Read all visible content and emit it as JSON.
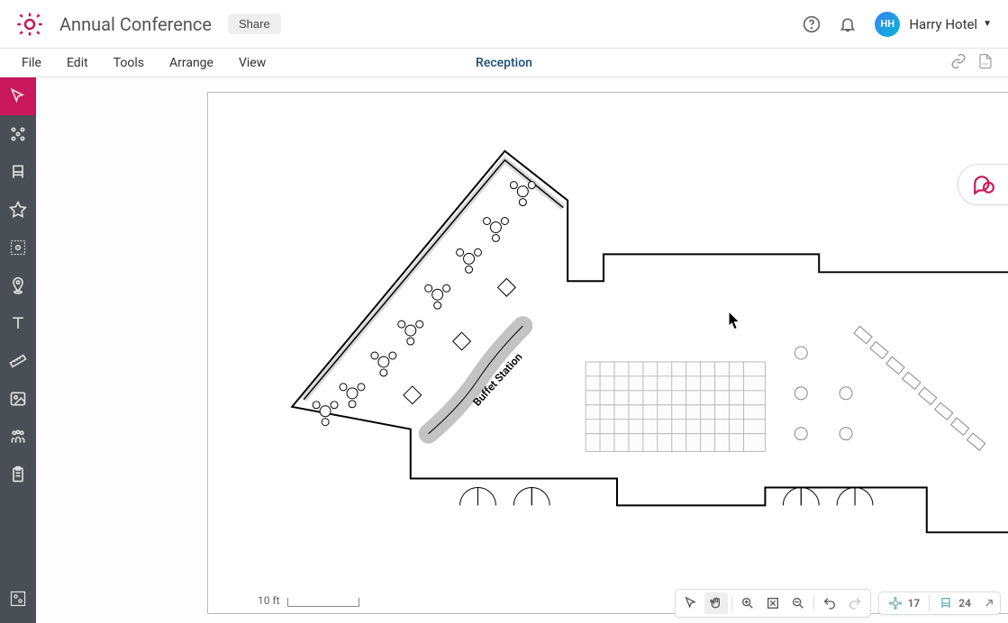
{
  "header": {
    "title": "Annual Conference",
    "share_label": "Share",
    "avatar_initials": "HH",
    "username": "Harry Hotel"
  },
  "menubar": {
    "file": "File",
    "edit": "Edit",
    "tools": "Tools",
    "arrange": "Arrange",
    "view": "View",
    "center": "Reception",
    "pdf_label": "PDF"
  },
  "canvas": {
    "buffet_label": "Buffet Station",
    "scale_label": "10 ft"
  },
  "status": {
    "count_a": "17",
    "count_b": "24"
  }
}
